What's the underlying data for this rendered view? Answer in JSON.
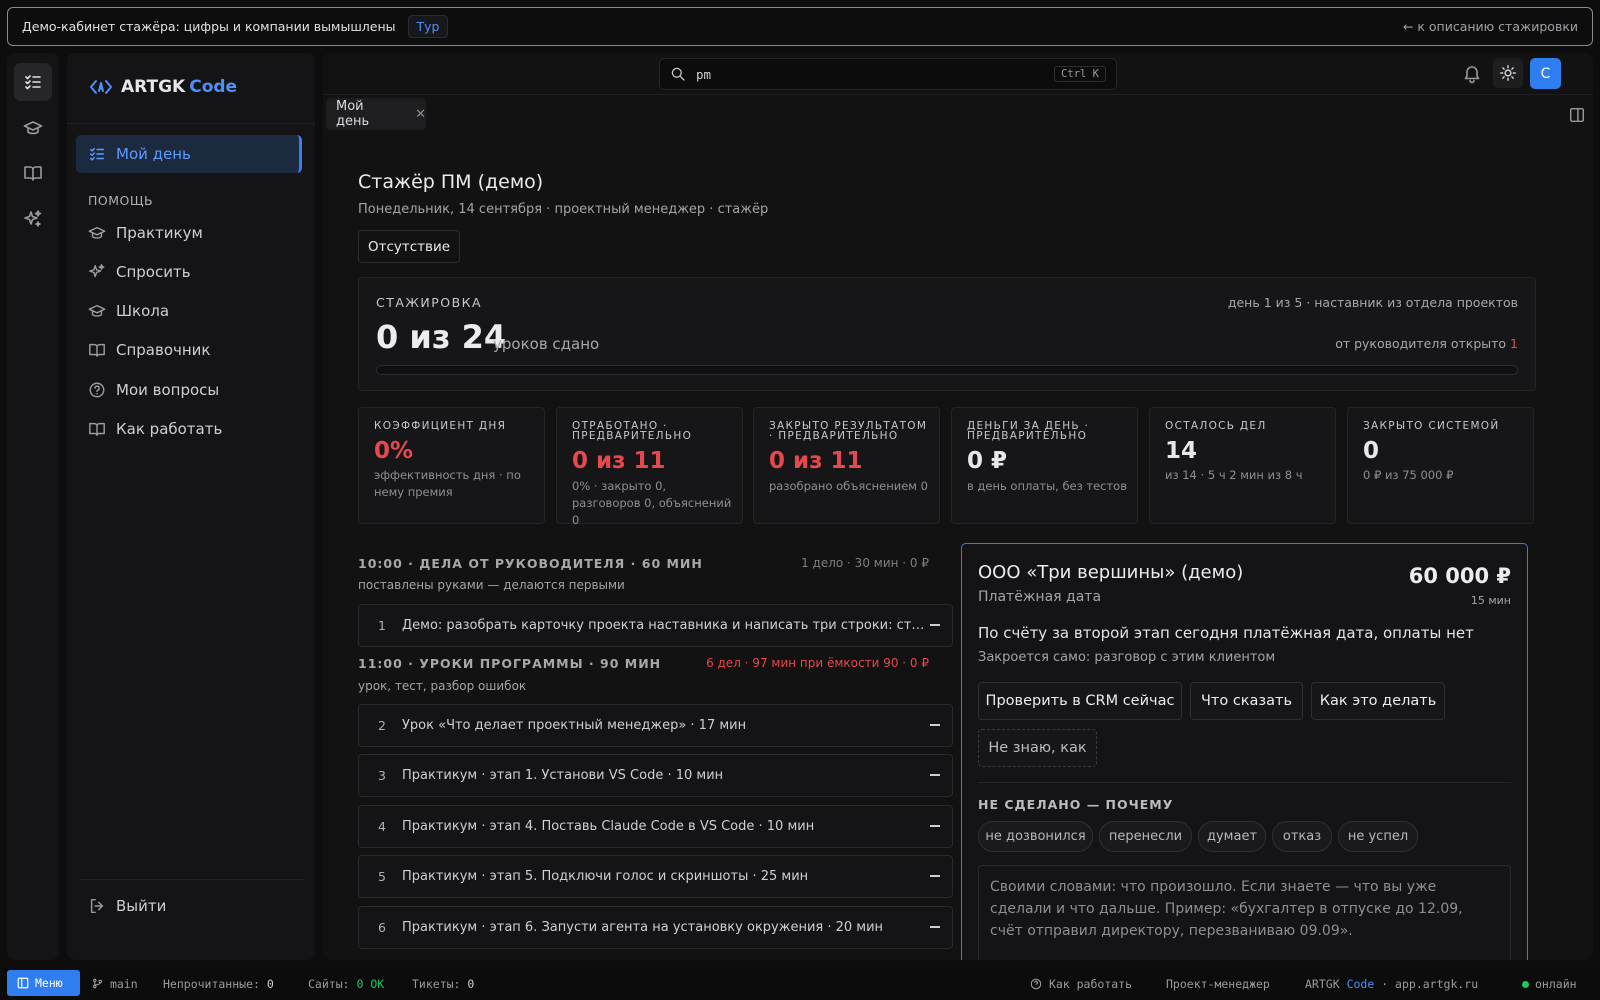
{
  "banner": {
    "text": "Демо-кабинет стажёра: цифры и компании вымышлены",
    "tour": "Тур",
    "back": "← к описанию стажировки"
  },
  "sidebar": {
    "logo_main": "ARTGK",
    "logo_code": "Code",
    "active_item": "Мой день",
    "help_label": "ПОМОЩЬ",
    "items": [
      "Практикум",
      "Спросить",
      "Школа",
      "Справочник",
      "Мои вопросы",
      "Как работать"
    ],
    "logout": "Выйти"
  },
  "topbar": {
    "search_value": "pm",
    "search_shortcut": "Ctrl K",
    "avatar": "С"
  },
  "tab": {
    "label": "Мой день",
    "close": "✕"
  },
  "page": {
    "title": "Стажёр ПМ (демо)",
    "subtitle": "Понедельник, 14 сентября · проектный менеджер · стажёр",
    "absence_button": "Отсутствие"
  },
  "internship": {
    "label": "СТАЖИРОВКА",
    "big": "0 из 24",
    "unit": "уроков сдано",
    "right_top": "день 1 из 5 · наставник из отдела проектов",
    "right_bottom_text": "от руководителя открыто ",
    "right_bottom_count": "1",
    "progress": 0
  },
  "kpis": [
    {
      "label": "КОЭФФИЦИЕНТ ДНЯ",
      "value": "0%",
      "note": "эффективность дня · по нему премия",
      "tone": "red"
    },
    {
      "label": "ОТРАБОТАНО · ПРЕДВАРИТЕЛЬНО",
      "value": "0 из 11",
      "note": "0% · закрыто 0, разговоров 0, объяснений 0",
      "tone": "red"
    },
    {
      "label": "ЗАКРЫТО РЕЗУЛЬТАТОМ · ПРЕДВАРИТЕЛЬНО",
      "value": "0 из 11",
      "note": "разобрано объяснением 0",
      "tone": "red"
    },
    {
      "label": "ДЕНЬГИ ЗА ДЕНЬ · ПРЕДВАРИТЕЛЬНО",
      "value": "0 ₽",
      "note": "в день оплаты, без тестов",
      "tone": "white"
    },
    {
      "label": "ОСТАЛОСЬ ДЕЛ",
      "value": "14",
      "note": "из 14 · 5 ч 2 мин из 8 ч",
      "tone": "white"
    },
    {
      "label": "ЗАКРЫТО СИСТЕМОЙ",
      "value": "0",
      "note": "0 ₽ из 75 000 ₽",
      "tone": "white"
    }
  ],
  "section1": {
    "title": "10:00 · ДЕЛА ОТ РУКОВОДИТЕЛЯ · 60 МИН",
    "right": "1 дело · 30 мин · 0 ₽",
    "sub": "поставлены руками — делаются первыми",
    "tasks": [
      {
        "n": "1",
        "text": "Демо: разобрать карточку проекта наставника и написать три строки: статус, риск, следующий шаг"
      }
    ]
  },
  "section2": {
    "title": "11:00 · УРОКИ ПРОГРАММЫ · 90 МИН",
    "right": "6 дел · 97 мин при ёмкости 90 · 0 ₽",
    "sub": "урок, тест, разбор ошибок",
    "tasks": [
      {
        "n": "2",
        "text": "Урок «Что делает проектный менеджер» · 17 мин"
      },
      {
        "n": "3",
        "text": "Практикум · этап 1. Установи VS Code · 10 мин"
      },
      {
        "n": "4",
        "text": "Практикум · этап 4. Поставь Claude Code в VS Code · 10 мин"
      },
      {
        "n": "5",
        "text": "Практикум · этап 5. Подключи голос и скриншоты · 25 мин"
      },
      {
        "n": "6",
        "text": "Практикум · этап 6. Запусти агента на установку окружения · 20 мин"
      }
    ]
  },
  "client": {
    "name": "ООО «Три вершины» (демо)",
    "type": "Платёжная дата",
    "amount": "60 000 ₽",
    "duration": "15 мин",
    "message": "По счёту за второй этап сегодня платёжная дата, оплаты нет",
    "auto_close": "Закроется само: разговор с этим клиентом",
    "buttons": [
      "Проверить в CRM сейчас",
      "Что сказать",
      "Как это делать"
    ],
    "dont_know": "Не знаю, как",
    "not_done_label": "НЕ СДЕЛАНО — ПОЧЕМУ",
    "reasons": [
      "не дозвонился",
      "перенесли",
      "думает",
      "отказ",
      "не успел"
    ],
    "placeholder": "Своими словами: что произошло. Если знаете — что вы уже сделали и что дальше. Пример: «бухгалтер в отпуске до 12.09, счёт отправил директору, перезваниваю 09.09»."
  },
  "statusbar": {
    "menu": "Меню",
    "branch": "main",
    "unread_label": "Непрочитанные:",
    "unread_value": "0",
    "sites_label": "Сайты:",
    "sites_value": "0 OK",
    "tickets_label": "Тикеты:",
    "tickets_value": "0",
    "how_to": "Как работать",
    "role": "Проект-менеджер",
    "brand_main": "ARTGK",
    "brand_code": "Code",
    "domain": "· app.artgk.ru",
    "online": "онлайн"
  },
  "colors": {
    "accent": "#2f7ef0",
    "danger": "#e5484d",
    "ok": "#22c55e"
  }
}
